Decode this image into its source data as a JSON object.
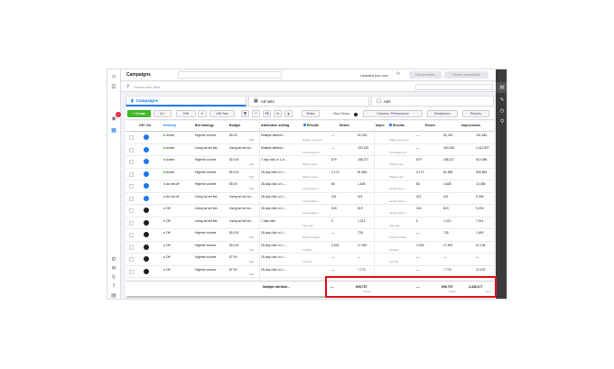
{
  "topbar": {
    "title": "Campaigns",
    "status": "Updated just now",
    "discard_label": "Discard drafts",
    "review_label": "Review and publish",
    "more_label": "—"
  },
  "search": {
    "placeholder": "Search and filter"
  },
  "tabs": [
    {
      "label": "Campaigns",
      "icon": "folder-icon"
    },
    {
      "label": "Ad sets",
      "icon": "grid-icon"
    },
    {
      "label": "Ads",
      "icon": "ad-icon"
    }
  ],
  "toolbar": {
    "create_label": "+ Create",
    "edit_label": "Edit",
    "ab_test_label": "A/B Test",
    "rules_label": "Rules",
    "view_setup_label": "View Setup",
    "columns_label": "Columns: Performance",
    "breakdown_label": "Breakdown",
    "reports_label": "Reports"
  },
  "table": {
    "headers": {
      "offon": "Off / On",
      "delivery": "Delivery",
      "bid_strategy": "Bid strategy",
      "budget": "Budget",
      "attribution": "Attribution setting",
      "results": "Results",
      "reach": "Reach",
      "impressions_short": "Impre",
      "results2": "Results",
      "reach2": "Reach",
      "impressions": "Impressions"
    },
    "rows": [
      {
        "on": true,
        "delivery": "Active",
        "status_color": "#42b72a",
        "bid": "Highest volume",
        "budget": "$5.00",
        "budget_sub": "Daily",
        "attr": "Multiple attributi...",
        "results": "—",
        "results_sub": "Multiple conversions",
        "reach": "52,230",
        "results2": "—",
        "results2_sub": "Multiple conversions",
        "reach2": "52,230",
        "impr": "241,485"
      },
      {
        "on": true,
        "delivery": "Active",
        "status_color": "#42b72a",
        "bid": "Using ad set bid...",
        "budget": "Using ad set bu...",
        "budget_sub": "",
        "attr": "Multiple attributi...",
        "results": "—",
        "results_sub": "Post Engagement",
        "reach": "190,183",
        "results2": "—",
        "results2_sub": "Post Engagement",
        "reach2": "190,183",
        "impr": "1,212,997"
      },
      {
        "on": true,
        "delivery": "Active",
        "status_color": "#42b72a",
        "bid": "Highest volume",
        "budget": "$10.00",
        "budget_sub": "Daily",
        "attr": "7-day click or 1-d...",
        "results": "879",
        "results_sub": "Website Leads",
        "reach": "188,227",
        "results2": "879",
        "results2_sub": "Website Leads",
        "reach2": "188,227",
        "impr": "610,096"
      },
      {
        "on": true,
        "delivery": "Active",
        "status_color": "#42b72a",
        "bid": "Highest volume",
        "budget": "$10.00",
        "budget_sub": "Daily",
        "attr": "28-day click or 1-...",
        "results": "2,173",
        "results_sub": "Website Leads",
        "reach": "81,865",
        "results2": "2,173",
        "results2_sub": "Website Leads",
        "reach2": "81,865",
        "impr": "839,584"
      },
      {
        "on": true,
        "delivery": "Ad set off",
        "status_color": "#8a8d91",
        "bid": "Highest volume",
        "budget": "$5.00",
        "budget_sub": "Daily",
        "attr": "28-day click or 1-...",
        "results": "$0",
        "results_sub": "Landing Page Vi...",
        "reach": "1,608",
        "results2": "$0",
        "results2_sub": "Landing Page Vi...",
        "reach2": "1,608",
        "impr": "13,058"
      },
      {
        "on": true,
        "delivery": "Ad set off",
        "status_color": "#8a8d91",
        "bid": "Using ad set bid...",
        "budget": "Using ad set bu...",
        "budget_sub": "",
        "attr": "28-day click or 1-...",
        "results": "421",
        "results_sub": "Landing Page Vi...",
        "reach": "421",
        "results2": "421",
        "results2_sub": "Landing Page Vi...",
        "reach2": "421",
        "impr": "5,994"
      },
      {
        "on": false,
        "delivery": "Off",
        "status_color": "#8a8d91",
        "bid": "Using ad set bid...",
        "budget": "Using ad set bu...",
        "budget_sub": "",
        "attr": "28-day click or 1-...",
        "results": "318",
        "results_sub": "Landing Page Vi...",
        "reach": "819",
        "results2": "318",
        "results2_sub": "Landing Page Vi...",
        "reach2": "819",
        "impr": "9,230"
      },
      {
        "on": false,
        "delivery": "Off",
        "status_color": "#8a8d91",
        "bid": "Using ad set bid...",
        "budget": "Using ad set bu...",
        "budget_sub": "",
        "attr": "7-day click",
        "results": "5",
        "results_sub": "Page Likes",
        "reach": "1,013",
        "results2": "5",
        "results2_sub": "Page Likes",
        "reach2": "1,013",
        "impr": "7,914"
      },
      {
        "on": false,
        "delivery": "Off",
        "status_color": "#8a8d91",
        "bid": "Highest volume",
        "budget": "$10.00",
        "budget_sub": "Daily",
        "attr": "28-day click or 1-...",
        "results": "—",
        "results_sub": "Website Complete...",
        "reach": "728",
        "results2": "—",
        "results2_sub": "Website Complete...",
        "reach2": "728",
        "impr": "1,690"
      },
      {
        "on": false,
        "delivery": "Off",
        "status_color": "#8a8d91",
        "bid": "Highest volume",
        "budget": "$10.00",
        "budget_sub": "Daily",
        "attr": "28-day click or 1-...",
        "results": "2,533",
        "results_sub": "ThruPlays",
        "reach": "17,552",
        "results2": "2,533",
        "results2_sub": "ThruPlays",
        "reach2": "17,552",
        "impr": "21,136"
      },
      {
        "on": false,
        "delivery": "Off",
        "status_color": "#8a8d91",
        "bid": "Highest volume",
        "budget": "$7.00",
        "budget_sub": "Daily",
        "attr": "28-day click or 1-...",
        "results": "—",
        "results_sub": "Link Click",
        "reach": "—",
        "results2": "—",
        "results2_sub": "Link Click",
        "reach2": "—",
        "impr": "—"
      },
      {
        "on": false,
        "delivery": "Off",
        "status_color": "#8a8d91",
        "bid": "Highest volume",
        "budget": "$7.00",
        "budget_sub": "Daily",
        "attr": "28-day click or 1-...",
        "results": "—",
        "results_sub": "",
        "reach": "7,775",
        "results2": "—",
        "results2_sub": "",
        "reach2": "7,775",
        "impr": "12,103"
      }
    ],
    "footer": {
      "attr": "Multiple attributi...",
      "results": "—",
      "reach": "695,757",
      "reach_sub": "People",
      "results2": "—",
      "reach2": "695,757",
      "reach2_sub": "People",
      "impr": "3,436,177",
      "impr_sub": "Total"
    }
  },
  "colors": {
    "accent": "#1877f2",
    "create": "#42b72a",
    "highlight": "#e0141e",
    "side_panel": "#3a3b3c"
  }
}
